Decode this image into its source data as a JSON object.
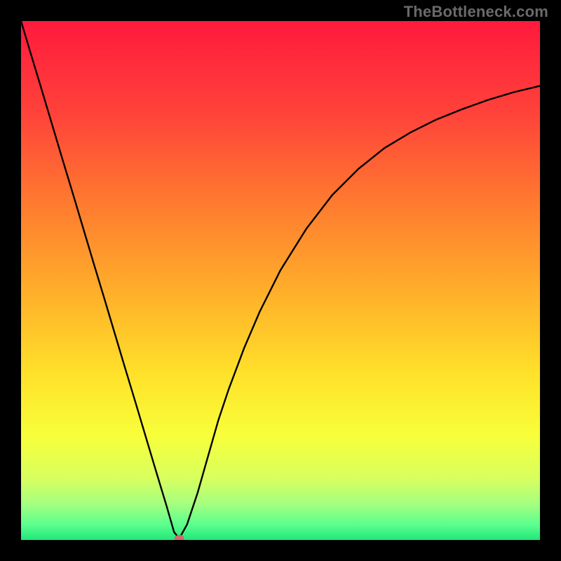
{
  "watermark": "TheBottleneck.com",
  "chart_data": {
    "type": "line",
    "title": "",
    "xlabel": "",
    "ylabel": "",
    "xlim": [
      0,
      100
    ],
    "ylim": [
      0,
      100
    ],
    "grid": false,
    "legend": false,
    "background_gradient": {
      "stops": [
        {
          "offset": 0.0,
          "color": "#ff1a3d"
        },
        {
          "offset": 0.18,
          "color": "#ff433a"
        },
        {
          "offset": 0.35,
          "color": "#ff7a2f"
        },
        {
          "offset": 0.52,
          "color": "#ffae2a"
        },
        {
          "offset": 0.68,
          "color": "#ffe12a"
        },
        {
          "offset": 0.8,
          "color": "#f8ff3a"
        },
        {
          "offset": 0.88,
          "color": "#d8ff5e"
        },
        {
          "offset": 0.93,
          "color": "#a6ff7f"
        },
        {
          "offset": 0.97,
          "color": "#5cff8e"
        },
        {
          "offset": 1.0,
          "color": "#22e77a"
        }
      ]
    },
    "series": [
      {
        "name": "bottleneck-curve",
        "type": "line",
        "color": "#000000",
        "x": [
          0.0,
          2.0,
          4.0,
          6.0,
          8.0,
          10.0,
          12.0,
          14.0,
          16.0,
          18.0,
          20.0,
          22.0,
          24.0,
          26.0,
          28.0,
          29.5,
          30.5,
          32.0,
          34.0,
          36.0,
          38.0,
          40.0,
          43.0,
          46.0,
          50.0,
          55.0,
          60.0,
          65.0,
          70.0,
          75.0,
          80.0,
          85.0,
          90.0,
          95.0,
          100.0
        ],
        "y": [
          100.0,
          93.3,
          86.7,
          80.0,
          73.3,
          66.7,
          60.0,
          53.3,
          46.7,
          40.0,
          33.3,
          26.7,
          20.0,
          13.3,
          6.7,
          1.5,
          0.3,
          3.0,
          9.0,
          16.0,
          23.0,
          29.0,
          37.0,
          44.0,
          52.0,
          60.0,
          66.5,
          71.5,
          75.5,
          78.5,
          81.0,
          83.0,
          84.8,
          86.3,
          87.5
        ]
      }
    ],
    "marker": {
      "name": "optimal-point",
      "x": 30.5,
      "y": 0.3,
      "color": "#cc6b6b",
      "rx": 7,
      "ry": 5
    }
  }
}
